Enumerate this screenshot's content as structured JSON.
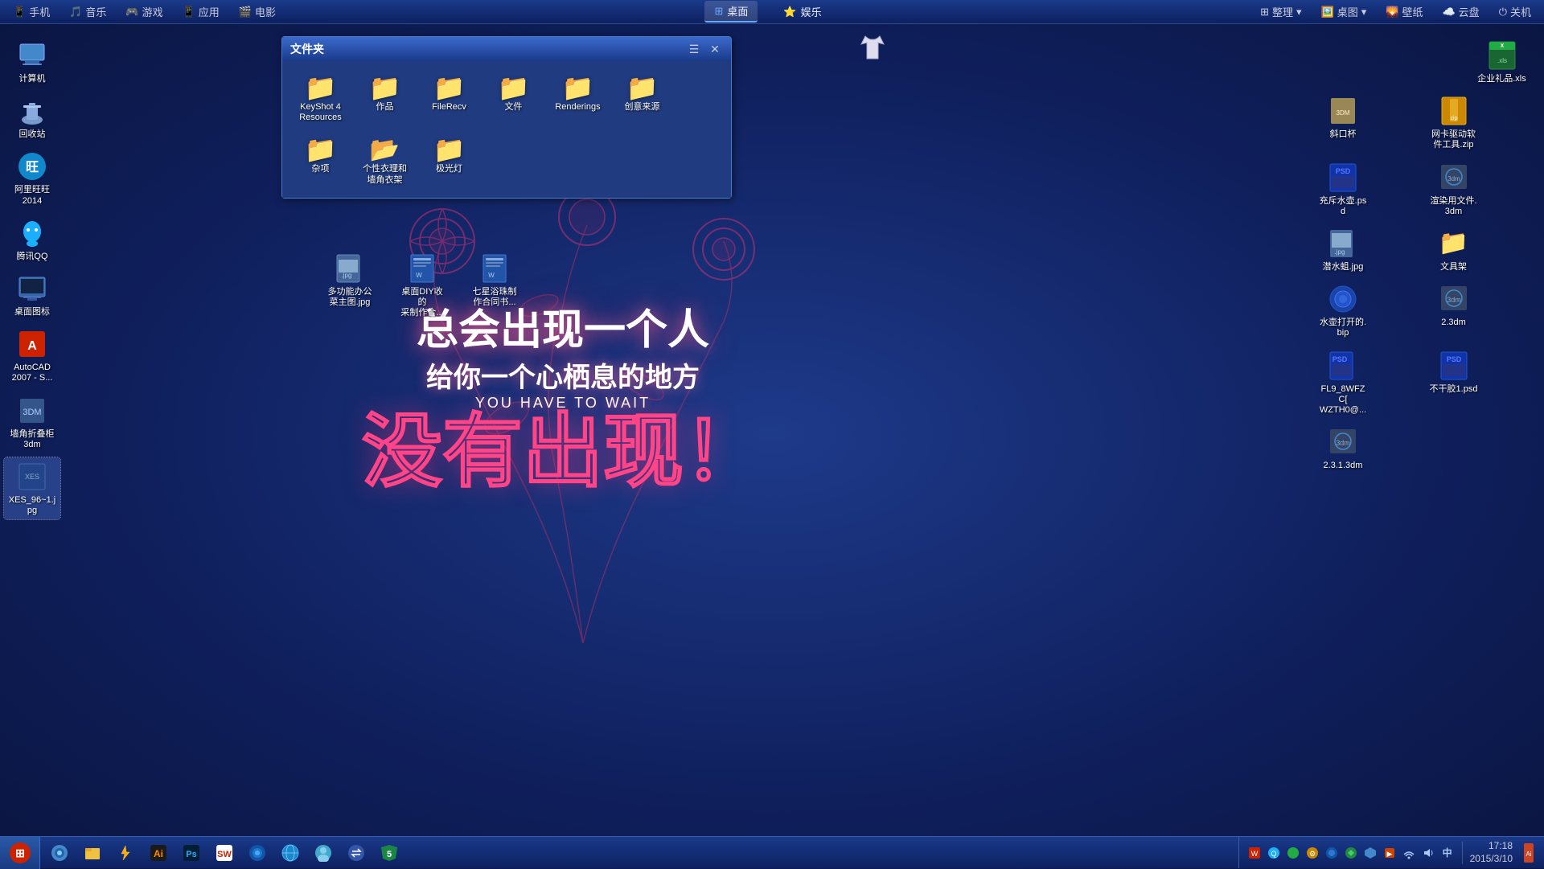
{
  "topbar": {
    "left_items": [
      {
        "icon": "📱",
        "label": "手机"
      },
      {
        "icon": "🎵",
        "label": "音乐"
      },
      {
        "icon": "🎮",
        "label": "游戏"
      },
      {
        "icon": "📱",
        "label": "应用"
      },
      {
        "icon": "🎬",
        "label": "电影"
      }
    ],
    "tabs": [
      {
        "icon": "🪟",
        "label": "桌面",
        "active": true
      },
      {
        "icon": "⭐",
        "label": "娱乐",
        "active": false
      }
    ],
    "right_items": [
      {
        "label": "整理"
      },
      {
        "label": "桌图"
      },
      {
        "label": "壁纸"
      },
      {
        "label": "云盘"
      },
      {
        "label": "关机"
      }
    ]
  },
  "left_icons": [
    {
      "id": "computer",
      "label": "计算机",
      "icon": "💻"
    },
    {
      "id": "recycle",
      "label": "回收站",
      "icon": "🗑️"
    },
    {
      "id": "alibaba",
      "label": "阿里旺旺\n2014",
      "icon": "💬"
    },
    {
      "id": "qq",
      "label": "腾讯QQ",
      "icon": "🐧"
    },
    {
      "id": "desktop-icon",
      "label": "桌面图标",
      "icon": "🖼️"
    },
    {
      "id": "autocad",
      "label": "AutoCAD\n2007 - S...",
      "icon": "📐"
    },
    {
      "id": "wall-shelf",
      "label": "墙角折叠柜\n3dm",
      "icon": "📦"
    },
    {
      "id": "xes",
      "label": "XES_96~1.j\npg",
      "icon": "🖼️",
      "selected": true
    }
  ],
  "folder_window": {
    "title": "文件夹",
    "items": [
      {
        "label": "KeyShot 4\nResources",
        "icon": "folder"
      },
      {
        "label": "作品",
        "icon": "folder"
      },
      {
        "label": "FileRecv",
        "icon": "folder"
      },
      {
        "label": "文件",
        "icon": "folder"
      },
      {
        "label": "Renderings",
        "icon": "folder"
      },
      {
        "label": "创意来源",
        "icon": "folder"
      },
      {
        "label": "杂项",
        "icon": "folder"
      },
      {
        "label": "个性衣理和\n墙角衣架",
        "icon": "folder"
      },
      {
        "label": "极光灯",
        "icon": "folder"
      }
    ]
  },
  "desktop_files": [
    {
      "label": "多功能办公\n菜主图.jpg",
      "icon": "img"
    },
    {
      "label": "桌面DIY收的\n采制作合...",
      "icon": "doc"
    },
    {
      "label": "七星浴珠制\n作合同书...",
      "icon": "doc"
    }
  ],
  "right_icons": [
    {
      "label": "企业礼品.xls",
      "icon": "excel",
      "col": 2
    },
    {
      "label": "斜口杯",
      "icon": "file3d",
      "col": 1
    },
    {
      "label": "网卡驱动软\n件工具.zip",
      "icon": "zip",
      "col": 2
    },
    {
      "label": "充斥水壶.psd",
      "icon": "psd",
      "col": 1
    },
    {
      "label": "渲染用文件.\n3dm",
      "icon": "3dm",
      "col": 2
    },
    {
      "label": "潜水蛆.jpg",
      "icon": "img",
      "col": 3
    },
    {
      "label": "水壶打开的.\nbip",
      "icon": "3d",
      "col": 1
    },
    {
      "label": "2.3dm",
      "icon": "3dm",
      "col": 2
    },
    {
      "label": "FL9_8WFZC[\nWZTH0@...",
      "icon": "img",
      "col": 3
    },
    {
      "label": "文具架",
      "icon": "folder-gold",
      "col": 4
    },
    {
      "label": "不干胶1.psd",
      "icon": "psd",
      "col": 3
    },
    {
      "label": "2.3.1.3dm",
      "icon": "3dm",
      "col": 1
    }
  ],
  "wallpaper": {
    "line1": "总会出现一个人",
    "line2": "给你一个心栖息的地方",
    "line3": "YOU HAVE TO WAIT",
    "line4": "没有出现！"
  },
  "taskbar": {
    "apps": [
      {
        "label": "开始",
        "icon": "start"
      },
      {
        "label": "桌面向导",
        "icon": "wizard"
      },
      {
        "label": "文件管理",
        "icon": "folder"
      },
      {
        "label": "Illustrator",
        "icon": "ai"
      },
      {
        "label": "Photoshop",
        "icon": "ps"
      },
      {
        "label": "SolidWorks",
        "icon": "sw"
      },
      {
        "label": "3D软件",
        "icon": "3d"
      },
      {
        "label": "浏览器",
        "icon": "browser"
      },
      {
        "label": "人物头像",
        "icon": "avatar"
      },
      {
        "label": "传输",
        "icon": "transfer"
      },
      {
        "label": "5号软件",
        "icon": "app5"
      }
    ],
    "tray": {
      "time": "17:18",
      "date": "2015/3/10"
    }
  }
}
